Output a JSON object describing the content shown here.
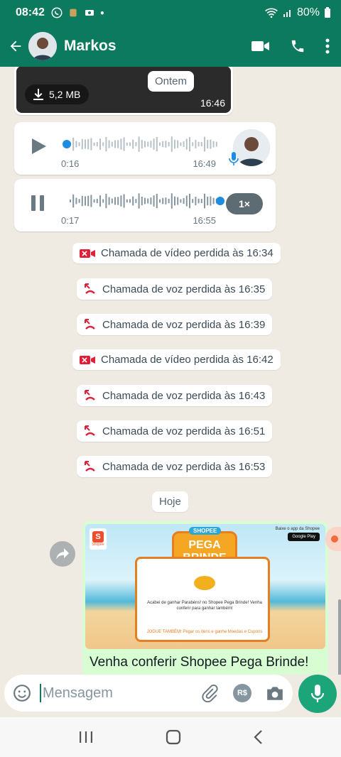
{
  "status": {
    "time": "08:42",
    "battery": "80%"
  },
  "header": {
    "contact_name": "Markos"
  },
  "chat": {
    "video": {
      "size": "5,2 MB",
      "time": "16:46"
    },
    "date_ontem": "Ontem",
    "audio1": {
      "duration": "0:16",
      "time": "16:49"
    },
    "audio2": {
      "duration": "0:17",
      "time": "16:55",
      "speed": "1×"
    },
    "calls": [
      {
        "type": "video",
        "text": "Chamada de vídeo perdida às 16:34"
      },
      {
        "type": "voice",
        "text": "Chamada de voz perdida às 16:35"
      },
      {
        "type": "voice",
        "text": "Chamada de voz perdida às 16:39"
      },
      {
        "type": "video",
        "text": "Chamada de vídeo perdida às 16:42"
      },
      {
        "type": "voice",
        "text": "Chamada de voz perdida às 16:43"
      },
      {
        "type": "voice",
        "text": "Chamada de voz perdida às 16:51"
      },
      {
        "type": "voice",
        "text": "Chamada de voz perdida às 16:53"
      }
    ],
    "date_hoje": "Hoje",
    "link_message": {
      "text": "Venha conferir Shopee Pega Brinde!",
      "image": {
        "shopee_label": "Shopee",
        "badge_top": "SHOPEE",
        "badge_title": "PEGA BRINDE",
        "google_play_caption": "Baixe o app da Shopee",
        "google_play_label": "Google Play",
        "promo_text": "Acabei de ganhar Parabéns! no Shopee Pega Brinde! Venha conferir para ganhar também!",
        "promo_cta": "JOGUE TAMBÉM! Pegar os itens e ganhe Moedas e Cupons"
      }
    }
  },
  "composer": {
    "placeholder": "Mensagem",
    "pix_label": "R$"
  },
  "colors": {
    "primary": "#0b7a5e",
    "chat_bg": "#efeae2",
    "outgoing": "#d9fdd3",
    "missed": "#e01e37",
    "accent_blue": "#1e8de0",
    "fab": "#1da57a"
  }
}
